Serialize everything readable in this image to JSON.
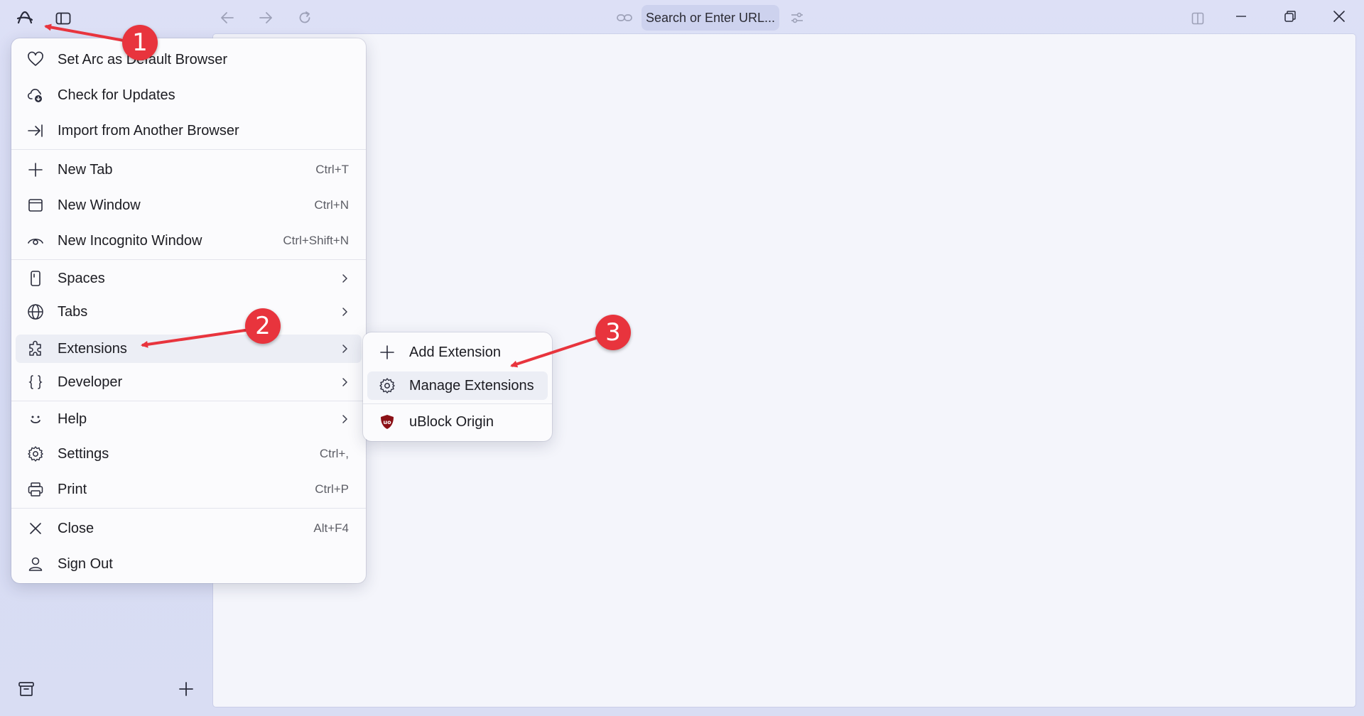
{
  "toolbar": {
    "url_placeholder": "Search or Enter URL..."
  },
  "main_menu": {
    "items": [
      {
        "label": "Set Arc as Default Browser",
        "shortcut": ""
      },
      {
        "label": "Check for Updates",
        "shortcut": ""
      },
      {
        "label": "Import from Another Browser",
        "shortcut": ""
      },
      {
        "label": "New Tab",
        "shortcut": "Ctrl+T"
      },
      {
        "label": "New Window",
        "shortcut": "Ctrl+N"
      },
      {
        "label": "New Incognito Window",
        "shortcut": "Ctrl+Shift+N"
      },
      {
        "label": "Spaces",
        "shortcut": ""
      },
      {
        "label": "Tabs",
        "shortcut": ""
      },
      {
        "label": "Extensions",
        "shortcut": ""
      },
      {
        "label": "Developer",
        "shortcut": ""
      },
      {
        "label": "Help",
        "shortcut": ""
      },
      {
        "label": "Settings",
        "shortcut": "Ctrl+,"
      },
      {
        "label": "Print",
        "shortcut": "Ctrl+P"
      },
      {
        "label": "Close",
        "shortcut": "Alt+F4"
      },
      {
        "label": "Sign Out",
        "shortcut": ""
      }
    ]
  },
  "extensions_submenu": {
    "items": [
      {
        "label": "Add Extension"
      },
      {
        "label": "Manage Extensions"
      },
      {
        "label": "uBlock Origin"
      }
    ]
  },
  "annotations": {
    "step1": "1",
    "step2": "2",
    "step3": "3",
    "color": "#e8343d"
  },
  "icons": {
    "ublock_color": "#8b1016"
  }
}
